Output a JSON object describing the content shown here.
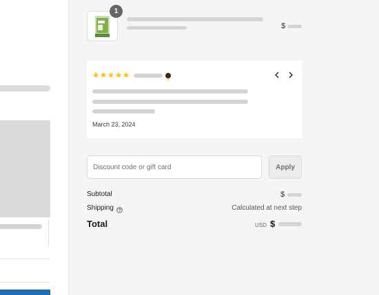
{
  "cart": {
    "item_quantity": "1",
    "product_thumbnail_icon": "product-package-icon",
    "price_symbol": "$"
  },
  "review": {
    "rating": 5,
    "rating_max": 5,
    "star_color": "#f5c518",
    "verified_icon": "verified-check-icon",
    "prev_icon": "chevron-left-icon",
    "next_icon": "chevron-right-icon",
    "date": "March 23, 2024"
  },
  "discount": {
    "placeholder": "Discount code or gift card",
    "value": "",
    "apply_label": "Apply"
  },
  "summary": {
    "subtotal_label": "Subtotal",
    "subtotal_symbol": "$",
    "shipping_label": "Shipping",
    "shipping_help_icon": "question-circle-icon",
    "shipping_value": "Calculated at next step",
    "total_label": "Total",
    "currency_code": "USD",
    "total_symbol": "$"
  }
}
